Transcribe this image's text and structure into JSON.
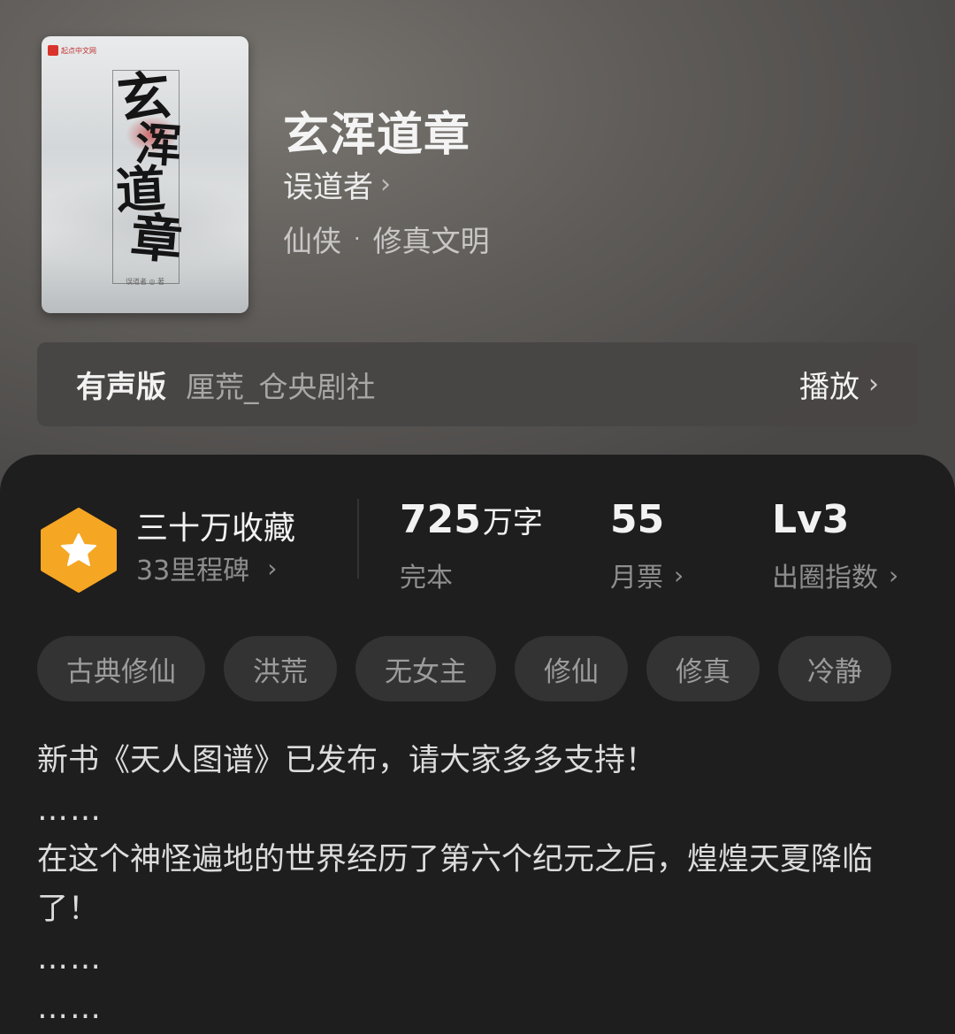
{
  "book": {
    "title": "玄浑道章",
    "author": "误道者",
    "category": "仙侠",
    "subcategory": "修真文明",
    "cover": {
      "publisher": "起点中文网",
      "title_chars": [
        "玄",
        "浑",
        "道",
        "章"
      ],
      "author_line": "误道者 ◎ 著"
    }
  },
  "audio": {
    "label": "有声版",
    "studio": "厘荒_仓央剧社",
    "play_label": "播放"
  },
  "stats": {
    "favorites": "三十万收藏",
    "milestones": "33里程碑",
    "word_count_value": "725",
    "word_count_unit": "万字",
    "status": "完本",
    "monthly_votes_value": "55",
    "monthly_votes_label": "月票",
    "popularity_value": "Lv3",
    "popularity_label": "出圈指数"
  },
  "tags": [
    "古典修仙",
    "洪荒",
    "无女主",
    "修仙",
    "修真",
    "冷静"
  ],
  "description": {
    "line1": "新书《天人图谱》已发布，请大家多多支持！",
    "ellipsis1": "……",
    "line2": "在这个神怪遍地的世界经历了第六个纪元之后，煌煌天夏降临了！",
    "ellipsis2": "……",
    "ellipsis3": "……"
  },
  "colors": {
    "badge_orange": "#f5a623",
    "panel_bg": "#1e1e1e",
    "tag_bg": "#333333"
  }
}
